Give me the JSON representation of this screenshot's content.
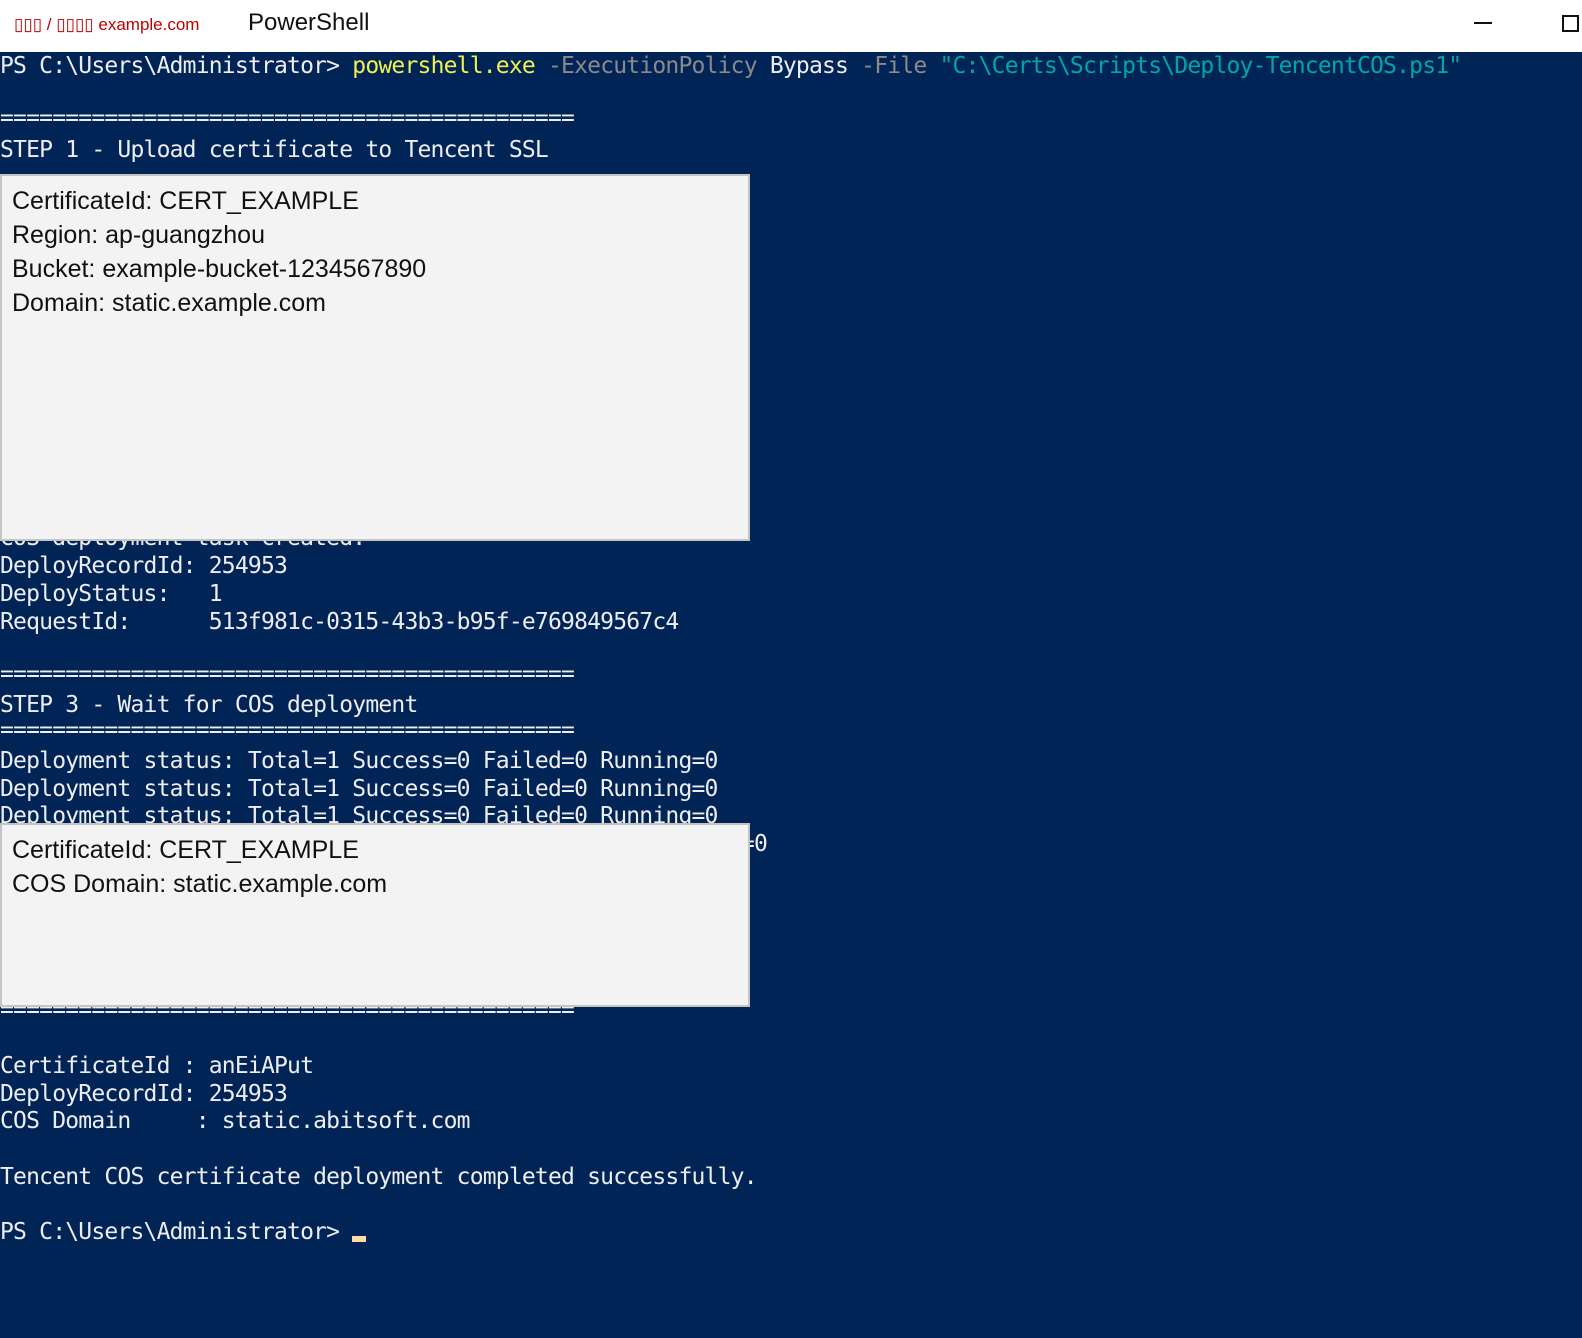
{
  "window": {
    "brand": "▯▯▯ / ▯▯▯▯ example.com",
    "title": "PowerShell"
  },
  "console": {
    "command": {
      "prompt": "PS C:\\Users\\Administrator> ",
      "exe": "powershell.exe",
      "param1": " -ExecutionPolicy",
      "arg1": " Bypass",
      "param2": " -File",
      "path": " \"C:\\Certs\\Scripts\\Deploy-TencentCOS.ps1\""
    },
    "lines": {
      "separator": "============================================",
      "step1": "STEP 1 - Upload certificate to Tencent SSL",
      "cos_task_created": "COS deployment task created.",
      "deploy_record_id": "DeployRecordId: 254953",
      "deploy_status": "DeployStatus:   1",
      "request_id": "RequestId:      513f981c-0315-43b3-b95f-e769849567c4",
      "step3": "STEP 3 - Wait for COS deployment",
      "deploy_progress": "Deployment status: Total=1 Success=0 Failed=0 Running=0",
      "partial_tail": "=0",
      "summary_cert_id": "CertificateId : anEiAPut",
      "summary_deploy_record_id": "DeployRecordId: 254953",
      "summary_domain": "COS Domain     : static.abitsoft.com",
      "success_message": "Tencent COS certificate deployment completed successfully.",
      "final_prompt": "PS C:\\Users\\Administrator> "
    }
  },
  "overlays": {
    "top": {
      "certificate_id": "CertificateId: CERT_EXAMPLE",
      "region": "Region: ap-guangzhou",
      "bucket": "Bucket: example-bucket-1234567890",
      "domain": "Domain: static.example.com"
    },
    "bottom": {
      "certificate_id": "CertificateId: CERT_EXAMPLE",
      "cos_domain": "COS Domain: static.example.com"
    }
  }
}
